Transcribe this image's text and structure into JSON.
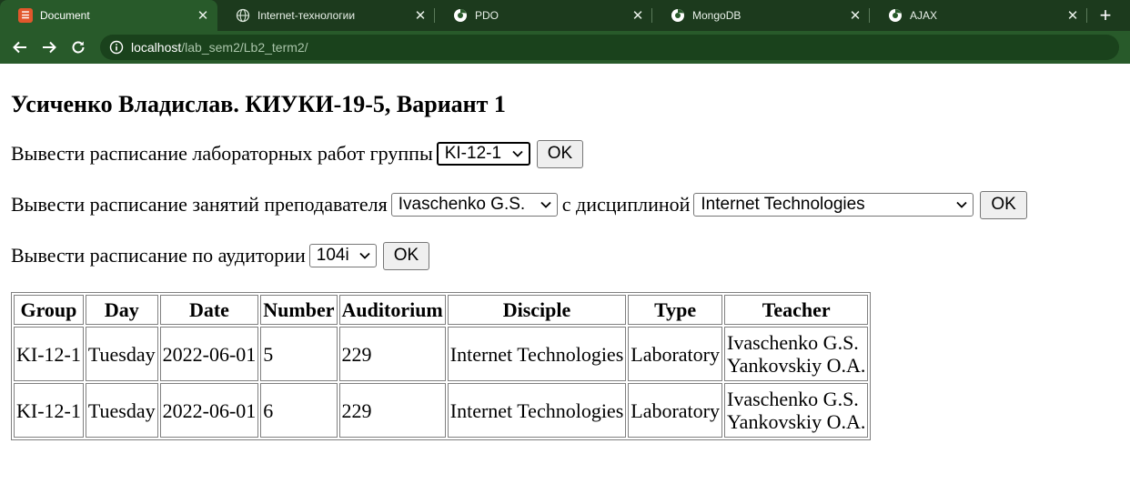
{
  "browser": {
    "tabs": [
      {
        "title": "Document",
        "icon": "html-doc-icon",
        "active": true
      },
      {
        "title": "Internet-технологии",
        "icon": "globe-icon",
        "active": false
      },
      {
        "title": "PDO",
        "icon": "globe-icon",
        "active": false
      },
      {
        "title": "MongoDB",
        "icon": "globe-icon",
        "active": false
      },
      {
        "title": "AJAX",
        "icon": "globe-icon",
        "active": false
      }
    ],
    "url_host": "localhost",
    "url_path": "/lab_sem2/Lb2_term2/"
  },
  "page": {
    "title": "Усиченко Владислав. КИУКИ-19-5, Вариант 1",
    "form_group": {
      "label": "Вывести расписание лабораторных работ группы",
      "select_value": "KI-12-1",
      "button": "OK"
    },
    "form_teacher": {
      "label": "Вывести расписание занятий преподавателя",
      "teacher_value": "Ivaschenko G.S.",
      "discipline_label": "с дисциплиной",
      "discipline_value": "Internet Technologies",
      "button": "OK"
    },
    "form_auditorium": {
      "label": "Вывести расписание по аудитории",
      "select_value": "104i",
      "button": "OK"
    },
    "table": {
      "headers": [
        "Group",
        "Day",
        "Date",
        "Number",
        "Auditorium",
        "Disciple",
        "Type",
        "Teacher"
      ],
      "rows": [
        {
          "group": "KI-12-1",
          "day": "Tuesday",
          "date": "2022-06-01",
          "number": "5",
          "auditorium": "229",
          "disciple": "Internet Technologies",
          "type": "Laboratory",
          "teacher1": "Ivaschenko G.S.",
          "teacher2": "Yankovskiy O.A."
        },
        {
          "group": "KI-12-1",
          "day": "Tuesday",
          "date": "2022-06-01",
          "number": "6",
          "auditorium": "229",
          "disciple": "Internet Technologies",
          "type": "Laboratory",
          "teacher1": "Ivaschenko G.S.",
          "teacher2": "Yankovskiy O.A."
        }
      ]
    }
  }
}
